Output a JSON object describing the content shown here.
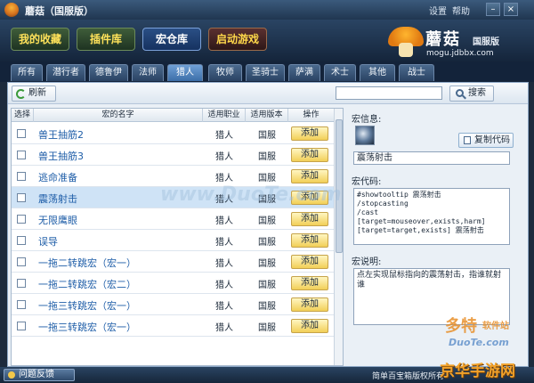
{
  "titlebar": {
    "title": "蘑菇（国服版）",
    "settings": "设置",
    "help": "帮助",
    "min": "–",
    "close": "×"
  },
  "header": {
    "buttons": [
      "我的收藏",
      "插件库",
      "宏仓库",
      "启动游戏"
    ],
    "logo_text": "蘑菇",
    "logo_edition": "国服版",
    "logo_url": "mogu.jdbbx.com"
  },
  "tabs": [
    "所有",
    "潜行者",
    "德鲁伊",
    "法师",
    "猎人",
    "牧师",
    "圣骑士",
    "萨满",
    "术士",
    "其他",
    "战士"
  ],
  "active_tab": "猎人",
  "toolbar": {
    "refresh": "刷新",
    "search_value": "",
    "search": "搜索"
  },
  "table": {
    "headers": [
      "选择",
      "宏的名字",
      "适用职业",
      "适用版本",
      "操作"
    ],
    "rows": [
      {
        "name": "兽王抽筋2",
        "job": "猎人",
        "ver": "国服",
        "action": "添加"
      },
      {
        "name": "兽王抽筋3",
        "job": "猎人",
        "ver": "国服",
        "action": "添加"
      },
      {
        "name": "逃命准备",
        "job": "猎人",
        "ver": "国服",
        "action": "添加"
      },
      {
        "name": "震荡射击",
        "job": "猎人",
        "ver": "国服",
        "action": "添加"
      },
      {
        "name": "无限鹰眼",
        "job": "猎人",
        "ver": "国服",
        "action": "添加"
      },
      {
        "name": "误导",
        "job": "猎人",
        "ver": "国服",
        "action": "添加"
      },
      {
        "name": "一拖二转跳宏（宏一）",
        "job": "猎人",
        "ver": "国服",
        "action": "添加"
      },
      {
        "name": "一拖二转跳宏（宏二）",
        "job": "猎人",
        "ver": "国服",
        "action": "添加"
      },
      {
        "name": "一拖三转跳宏（宏一）",
        "job": "猎人",
        "ver": "国服",
        "action": "添加"
      },
      {
        "name": "一拖三转跳宏（宏一）",
        "job": "猎人",
        "ver": "国服",
        "action": "添加"
      }
    ],
    "selected_index": 3
  },
  "panel": {
    "info_label": "宏信息:",
    "copy_button": "复制代码",
    "macro_name": "震荡射击",
    "code_label": "宏代码:",
    "code": "#showtooltip 震荡射击\n/stopcasting\n/cast\n[target=mouseover,exists,harm]\n[target=target,exists] 震荡射击",
    "desc_label": "宏说明:",
    "description": "点左实现鼠标指向的震荡射击，指谁就射谁"
  },
  "statusbar": {
    "feedback": "问题反馈",
    "copyright": "简单百宝箱版权所有"
  },
  "watermarks": {
    "center": "www.DuoTe.com",
    "brand1": "多特",
    "brand1_sub": "软件站",
    "brand2": "DuoTe.com",
    "brand3": "京华手游网"
  }
}
